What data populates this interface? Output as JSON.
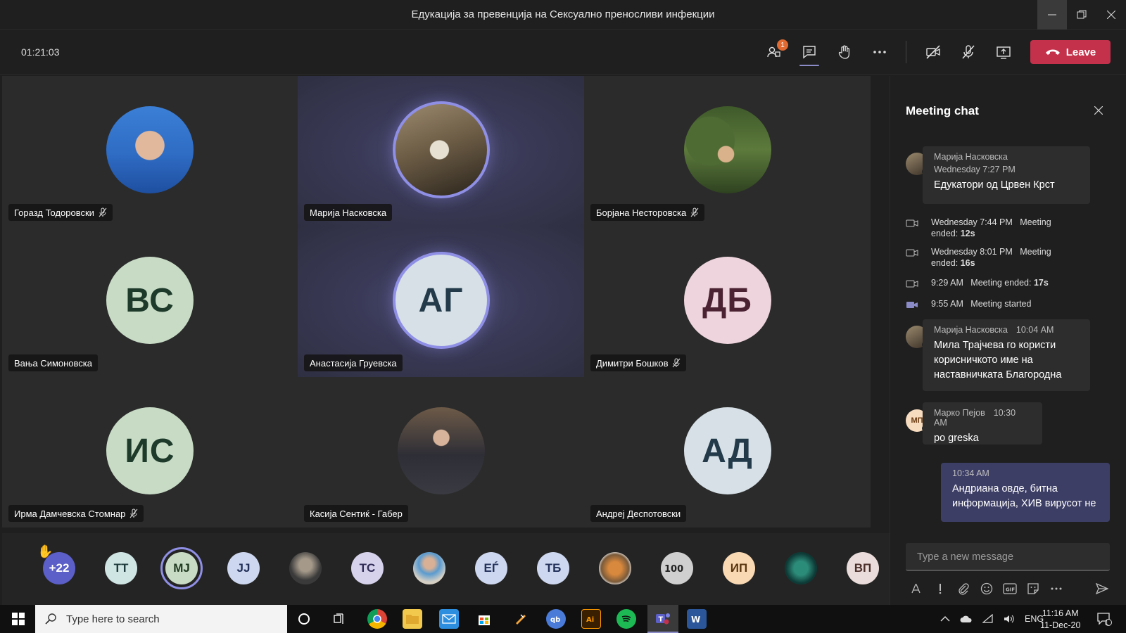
{
  "window": {
    "title": "Едукација за превенција на Сексуално преносливи инфекции",
    "minimize_icon": "minimize-icon",
    "maximize_icon": "restore-icon",
    "close_icon": "close-icon"
  },
  "toolbar": {
    "timer": "01:21:03",
    "participants_badge": "1",
    "leave_label": "Leave",
    "leave_color": "#c4314b"
  },
  "tiles": [
    {
      "name": "Горазд Тодоровски",
      "muted": true,
      "photo": true
    },
    {
      "name": "Марија Насковска",
      "muted": false,
      "photo": true,
      "speaking": true
    },
    {
      "name": "Борјана Несторовска",
      "muted": true,
      "photo": true
    },
    {
      "name": "Вања Симоновска",
      "initials": "ВС",
      "muted": false
    },
    {
      "name": "Анастасија Груевска",
      "initials": "АГ",
      "muted": false,
      "speaking": true
    },
    {
      "name": "Димитри Бошков",
      "initials": "ДБ",
      "muted": true
    },
    {
      "name": "Ирма Дамчевска Стомнар",
      "initials": "ИС",
      "muted": true
    },
    {
      "name": "Касија Сентиќ - Габер",
      "muted": false,
      "photo": true
    },
    {
      "name": "Андреј Деспотовски",
      "initials": "АД",
      "muted": false
    }
  ],
  "strip": {
    "overflow": "+22",
    "participants": [
      "TT",
      "MJ",
      "JJ",
      "",
      "TC",
      "",
      "EЃ",
      "ТБ",
      "",
      "",
      "ИП",
      "",
      "ВП"
    ]
  },
  "chat": {
    "title": "Meeting chat",
    "messages": [
      {
        "author": "Марија Насковска",
        "time": "Wednesday 7:27 PM",
        "text": "Едукатори од Црвен Крст"
      },
      {
        "author": "Марија Насковска",
        "time": "10:04 AM",
        "text": "Мила Трајчева го користи корисничкото име на наставничката Благородна"
      },
      {
        "author": "Марко Пејов",
        "time": "10:30 AM",
        "text": "po greska",
        "initials": "МП"
      },
      {
        "time": "10:34 AM",
        "text": "Андриана овде, битна информација, ХИВ вирусот не"
      }
    ],
    "system": [
      {
        "time": "Wednesday 7:44 PM",
        "label": "Meeting ended:",
        "duration": "12s"
      },
      {
        "time": "Wednesday 8:01 PM",
        "label": "Meeting ended:",
        "duration": "16s"
      },
      {
        "time": "9:29 AM",
        "label": "Meeting ended:",
        "duration": "17s"
      },
      {
        "time": "9:55 AM",
        "label": "Meeting started",
        "duration": ""
      }
    ],
    "compose_placeholder": "Type a new message"
  },
  "taskbar": {
    "search_placeholder": "Type here to search",
    "language": "ENG",
    "time": "11:16 AM",
    "date": "11-Dec-20",
    "notification_count": "1"
  }
}
